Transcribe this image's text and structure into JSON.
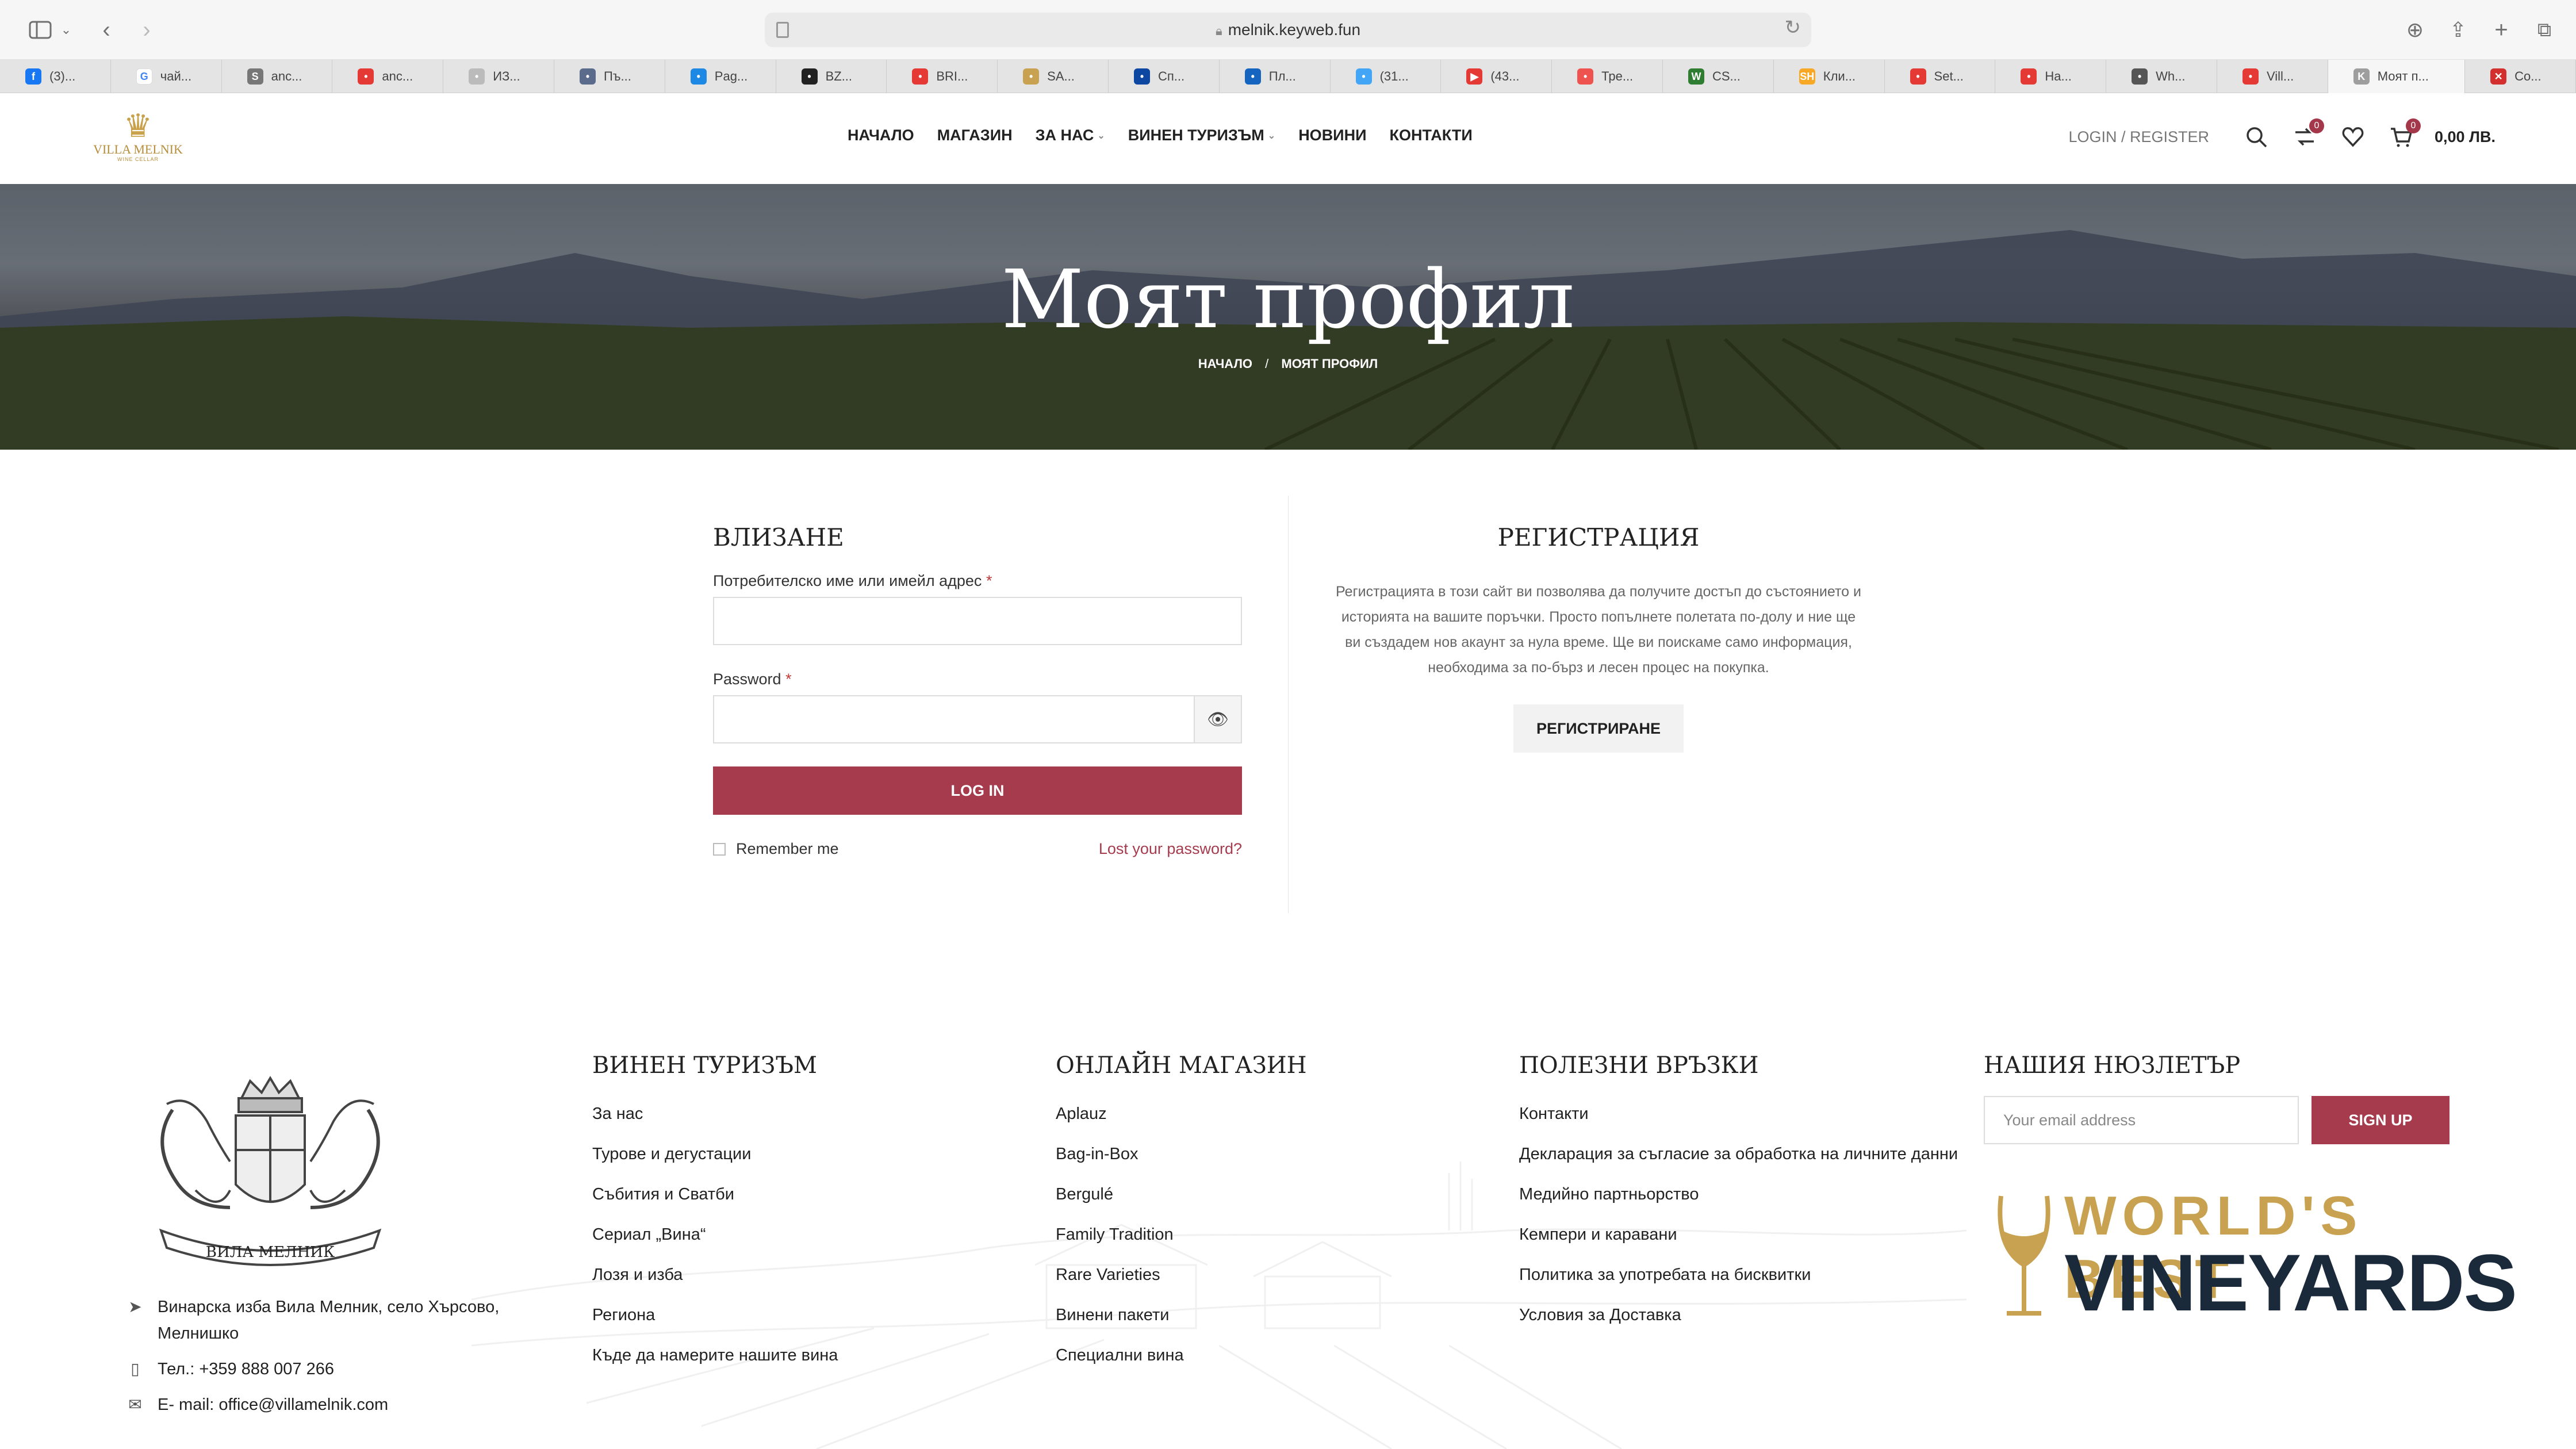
{
  "browser": {
    "url": "melnik.keyweb.fun",
    "tabs": [
      {
        "label": "(3)...",
        "color": "#1877f2",
        "glyph": "f"
      },
      {
        "label": "чай...",
        "color": "#ffffff",
        "glyph": "G"
      },
      {
        "label": "anc...",
        "color": "#777777",
        "glyph": "S"
      },
      {
        "label": "anc...",
        "color": "#e53935",
        "glyph": "•"
      },
      {
        "label": "ИЗ...",
        "color": "#bbbbbb",
        "glyph": "•"
      },
      {
        "label": "Пъ...",
        "color": "#5a6b8c",
        "glyph": "•"
      },
      {
        "label": "Pag...",
        "color": "#1e88e5",
        "glyph": "•"
      },
      {
        "label": "BZ...",
        "color": "#222222",
        "glyph": "•"
      },
      {
        "label": "BRI...",
        "color": "#e53935",
        "glyph": "•"
      },
      {
        "label": "SA...",
        "color": "#c8a250",
        "glyph": "•"
      },
      {
        "label": "Сп...",
        "color": "#0d47a1",
        "glyph": "•"
      },
      {
        "label": "Пл...",
        "color": "#1565c0",
        "glyph": "•"
      },
      {
        "label": "(31...",
        "color": "#42a5f5",
        "glyph": "•"
      },
      {
        "label": "(43...",
        "color": "#e53935",
        "glyph": "▶"
      },
      {
        "label": "Тре...",
        "color": "#ef5350",
        "glyph": "•"
      },
      {
        "label": "CS...",
        "color": "#2e7d32",
        "glyph": "W"
      },
      {
        "label": "Кли...",
        "color": "#f9a825",
        "glyph": "SH"
      },
      {
        "label": "Set...",
        "color": "#e53935",
        "glyph": "•"
      },
      {
        "label": "На...",
        "color": "#e53935",
        "glyph": "•"
      },
      {
        "label": "Wh...",
        "color": "#555555",
        "glyph": "•"
      },
      {
        "label": "Vill...",
        "color": "#e53935",
        "glyph": "•"
      },
      {
        "label": "Моят п...",
        "color": "#9e9e9e",
        "glyph": "K",
        "active": true
      },
      {
        "label": "Co...",
        "color": "#d32f2f",
        "glyph": "✕"
      }
    ]
  },
  "header": {
    "logo_name": "VILLA MELNIK",
    "logo_sub": "WINE CELLAR",
    "nav": [
      "НАЧАЛО",
      "МАГАЗИН",
      "ЗА НАС",
      "ВИНЕН ТУРИЗЪМ",
      "НОВИНИ",
      "КОНТАКТИ"
    ],
    "login_label": "LOGIN / REGISTER",
    "compare_count": "0",
    "cart_count": "0",
    "cart_total": "0,00 ЛВ."
  },
  "hero": {
    "title": "Моят профил",
    "breadcrumb_home": "НАЧАЛО",
    "breadcrumb_sep": "/",
    "breadcrumb_current": "МОЯТ ПРОФИЛ"
  },
  "login": {
    "title": "ВЛИЗАНЕ",
    "username_label": "Потребителско име или имейл адрес",
    "password_label": "Password",
    "required_mark": "*",
    "button": "LOG IN",
    "remember": "Remember me",
    "lost": "Lost your password?"
  },
  "register": {
    "title": "РЕГИСТРАЦИЯ",
    "text": "Регистрацията в този сайт ви позволява да получите достъп до състоянието и историята на вашите поръчки. Просто попълнете полетата по-долу и ние ще ви създадем нов акаунт за нула време. Ще ви поискаме само информация, необходима за по-бърз и лесен процес на покупка.",
    "button": "РЕГИСТРИРАНЕ"
  },
  "footer": {
    "crest_text": "ВИЛА МЕЛНИК",
    "address": "Винарска изба Вила Мелник, село Хърсово, Мелнишко",
    "phone": "Тел.: +359 888 007 266",
    "email": "E- mail: office@villamelnik.com",
    "col1": {
      "title": "ВИНЕН ТУРИЗЪМ",
      "links": [
        "За нас",
        "Турове и дегустации",
        "Събития и Сватби",
        "Сериал „Вина“",
        "Лозя и изба",
        "Регионa",
        "Къде да намерите нашите вина"
      ]
    },
    "col2": {
      "title": "ОНЛАЙН МАГАЗИН",
      "links": [
        "Aplauz",
        "Bag-in-Box",
        "Bergulé",
        "Family Tradition",
        "Rare Varieties",
        "Винени пакети",
        "Специални вина"
      ]
    },
    "col3": {
      "title": "ПОЛЕЗНИ ВРЪЗКИ",
      "links": [
        "Контакти",
        "Декларация за съгласие за обработка на личните данни",
        "Медийно партньорство",
        "Кемпери и каравани",
        "Политика за употребата на бисквитки",
        "Условия за Доставка"
      ]
    },
    "newsletter": {
      "title": "НАШИЯ НЮЗЛЕТЪР",
      "placeholder": "Your email address",
      "button": "SIGN UP"
    },
    "badge_line1": "WORLD'S BEST",
    "badge_line2": "VINEYARDS"
  }
}
